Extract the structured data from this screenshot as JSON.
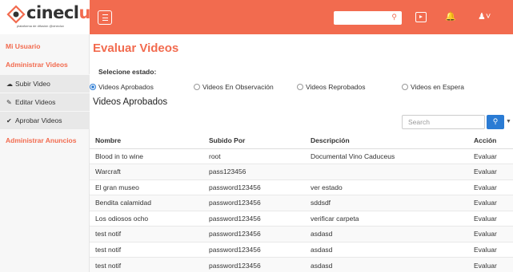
{
  "brand": {
    "name_left": "cinecl",
    "name_right": "uv",
    "tagline": "plataforma de difusión @cinecluv"
  },
  "topbar": {
    "search_placeholder": "",
    "icons": [
      "menu-icon",
      "search-icon",
      "video-icon",
      "bell-icon",
      "user-icon"
    ]
  },
  "sidebar": {
    "my_user": "Mi Usuario",
    "admin_videos": "Administrar Videos",
    "sub_items": [
      {
        "icon": "upload-icon",
        "label": "Subir Video"
      },
      {
        "icon": "pencil-icon",
        "label": "Editar Videos"
      },
      {
        "icon": "check-icon",
        "label": "Aprobar Videos"
      }
    ],
    "admin_ads": "Administrar Anuncios"
  },
  "main": {
    "title": "Evaluar Videos",
    "state_label": "Selecione estado:",
    "states": [
      {
        "label": "Videos Aprobados",
        "selected": true
      },
      {
        "label": "Videos En Observación",
        "selected": false
      },
      {
        "label": "Videos Reprobados",
        "selected": false
      },
      {
        "label": "Videos en Espera",
        "selected": false
      }
    ],
    "subtitle": "Videos Aprobados",
    "search_placeholder": "Search"
  },
  "table": {
    "headers": [
      "Nombre",
      "Subido Por",
      "Descripción",
      "Acción"
    ],
    "rows": [
      [
        "Blood in to wine",
        "root",
        "Documental Vino Caduceus",
        "Evaluar"
      ],
      [
        "Warcraft",
        "pass123456",
        "",
        "Evaluar"
      ],
      [
        "El gran museo",
        "password123456",
        "ver estado",
        "Evaluar"
      ],
      [
        "Bendita calamidad",
        "password123456",
        "sddsdf",
        "Evaluar"
      ],
      [
        "Los odiosos ocho",
        "password123456",
        "verificar carpeta",
        "Evaluar"
      ],
      [
        "test notif",
        "password123456",
        "asdasd",
        "Evaluar"
      ],
      [
        "test notif",
        "password123456",
        "asdasd",
        "Evaluar"
      ],
      [
        "test notif",
        "password123456",
        "asdasd",
        "Evaluar"
      ]
    ]
  },
  "colors": {
    "accent": "#f26b4f",
    "primary_button": "#2a7bd4",
    "sidebar_bg": "#f7f7f7",
    "sidebar_sub_bg": "#e8e8e8"
  }
}
